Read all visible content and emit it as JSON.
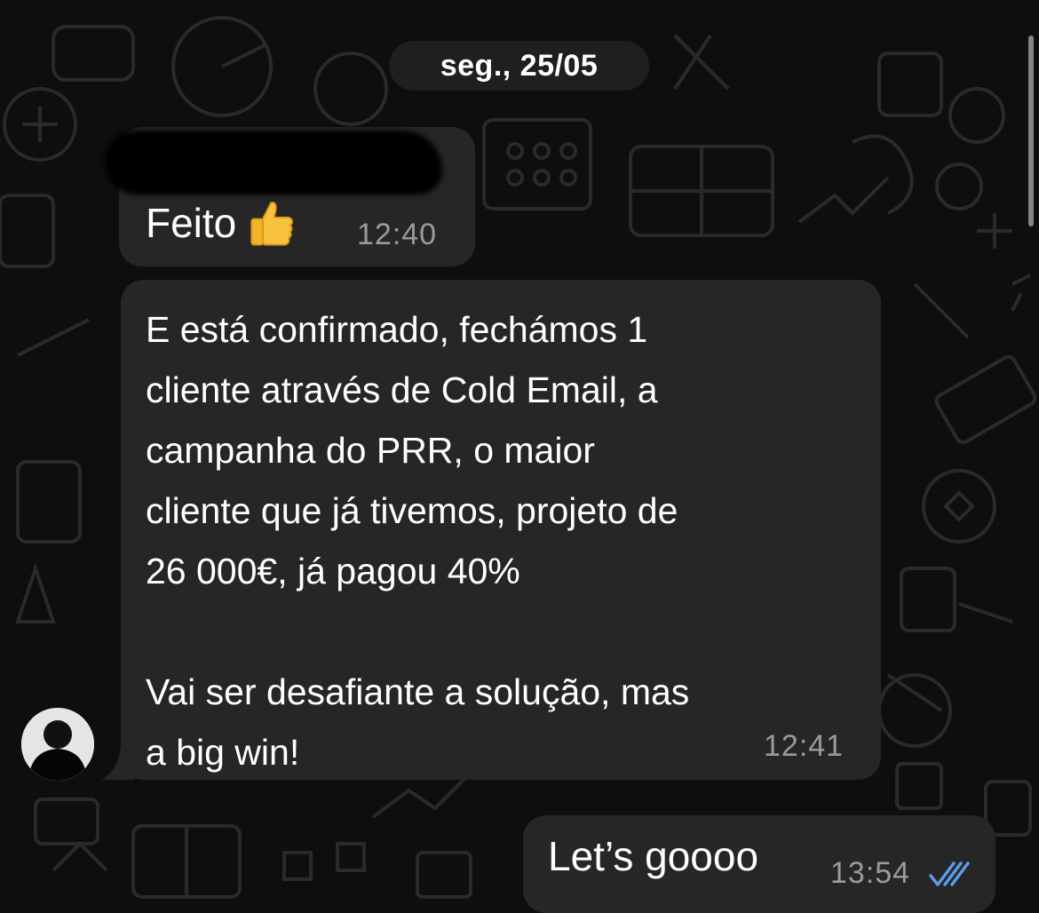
{
  "chat": {
    "date_separator": "seg., 25/05",
    "messages": [
      {
        "direction": "incoming",
        "sender_redacted": true,
        "text": "Feito",
        "emoji": "thumbs-up",
        "time": "12:40"
      },
      {
        "direction": "incoming",
        "text": "E está confirmado, fechámos 1\ncliente através de Cold Email, a\ncampanha do PRR, o maior\ncliente que já tivemos, projeto de\n26 000€, já pagou 40%\n\nVai ser desafiante a solução, mas\na big win!",
        "time": "12:41",
        "avatar": "contact-avatar"
      },
      {
        "direction": "outgoing",
        "text": "Let’s goooo",
        "time": "13:54",
        "status": "read",
        "status_icon": "double-check-icon"
      }
    ]
  },
  "colors": {
    "background": "#0e0e0e",
    "bubble": "#262626",
    "timestamp": "#9b9b9b",
    "read_ticks": "#5b9bea"
  }
}
